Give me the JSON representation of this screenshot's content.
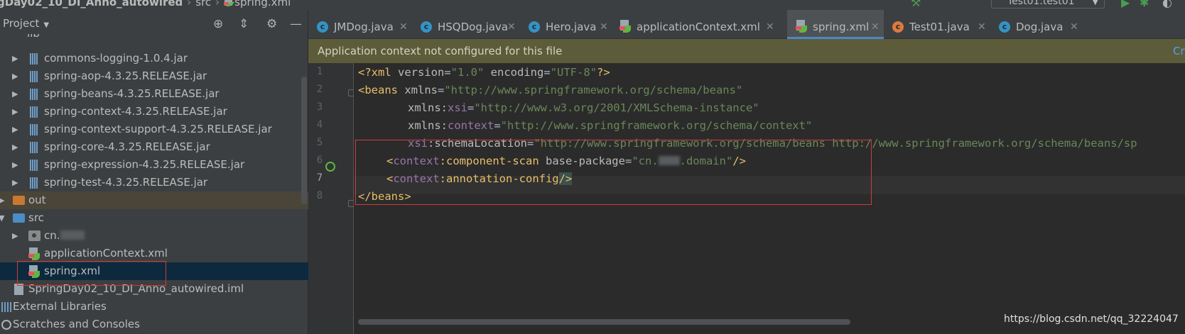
{
  "breadcrumb": {
    "project": "gDay02_10_DI_Anno_autowired",
    "folder": "src",
    "file": "spring.xml"
  },
  "run_config": "Test01.test01",
  "project_panel": {
    "title": "Project",
    "tree": [
      {
        "label": "lib",
        "kind": "folder"
      },
      {
        "label": "commons-logging-1.0.4.jar",
        "kind": "jar"
      },
      {
        "label": "spring-aop-4.3.25.RELEASE.jar",
        "kind": "jar"
      },
      {
        "label": "spring-beans-4.3.25.RELEASE.jar",
        "kind": "jar"
      },
      {
        "label": "spring-context-4.3.25.RELEASE.jar",
        "kind": "jar"
      },
      {
        "label": "spring-context-support-4.3.25.RELEASE.jar",
        "kind": "jar"
      },
      {
        "label": "spring-core-4.3.25.RELEASE.jar",
        "kind": "jar"
      },
      {
        "label": "spring-expression-4.3.25.RELEASE.jar",
        "kind": "jar"
      },
      {
        "label": "spring-test-4.3.25.RELEASE.jar",
        "kind": "jar"
      },
      {
        "label": "out",
        "kind": "folder-excluded"
      },
      {
        "label": "src",
        "kind": "folder-source"
      },
      {
        "label": "cn.",
        "kind": "package",
        "redacted": true
      },
      {
        "label": "applicationContext.xml",
        "kind": "xml"
      },
      {
        "label": "spring.xml",
        "kind": "xml",
        "selected": true
      },
      {
        "label": "SpringDay02_10_DI_Anno_autowired.iml",
        "kind": "iml"
      },
      {
        "label": "External Libraries",
        "kind": "libraries"
      },
      {
        "label": "Scratches and Consoles",
        "kind": "scratches"
      }
    ]
  },
  "tabs": [
    {
      "label": "JMDog.java",
      "icon": "class-icon"
    },
    {
      "label": "HSQDog.java",
      "icon": "class-icon"
    },
    {
      "label": "Hero.java",
      "icon": "class-icon"
    },
    {
      "label": "applicationContext.xml",
      "icon": "spring-xml-icon"
    },
    {
      "label": "spring.xml",
      "icon": "spring-xml-icon",
      "active": true
    },
    {
      "label": "Test01.java",
      "icon": "test-class-icon"
    },
    {
      "label": "Dog.java",
      "icon": "class-icon"
    }
  ],
  "banner": {
    "text": "Application context not configured for this file",
    "link": "Cr"
  },
  "editor": {
    "line_numbers": [
      "1",
      "2",
      "3",
      "4",
      "5",
      "6",
      "7",
      "8"
    ],
    "lines": {
      "l1": {
        "decl_open": "<?xml ",
        "k1": "version",
        "eq1": "=",
        "v1": "\"1.0\"",
        "k2": " encoding",
        "eq2": "=",
        "v2": "\"UTF-8\"",
        "decl_close": "?>"
      },
      "l2": {
        "open": "<beans ",
        "attr": "xmlns",
        "eq": "=",
        "val": "\"http://www.springframework.org/schema/beans\""
      },
      "l3": {
        "pre": "xmlns:",
        "ns": "xsi",
        "eq": "=",
        "val": "\"http://www.w3.org/2001/XMLSchema-instance\""
      },
      "l4": {
        "pre": "xmlns:",
        "ns": "context",
        "eq": "=",
        "val": "\"http://www.springframework.org/schema/context\""
      },
      "l5": {
        "ns": "xsi",
        "attr": ":schemaLocation",
        "eq": "=",
        "val": "\"http://www.springframework.org/schema/beans http://www.springframework.org/schema/beans/sp"
      },
      "l6": {
        "lt": "<",
        "ns": "context",
        "tag": ":component-scan ",
        "attr": "base-package",
        "eq": "=",
        "val_a": "\"cn.",
        "val_b": ".domain\"",
        "close": "/>"
      },
      "l7": {
        "lt": "<",
        "ns": "context",
        "tag": ":annotation-config",
        "close": "/>"
      },
      "l8": {
        "close": "</beans>"
      }
    }
  },
  "watermark": "https://blog.csdn.net/qq_32224047",
  "colors": {
    "highlight_box": "#d13b3b",
    "banner_bg": "#5c5c3a",
    "selection": "#0d293e"
  }
}
